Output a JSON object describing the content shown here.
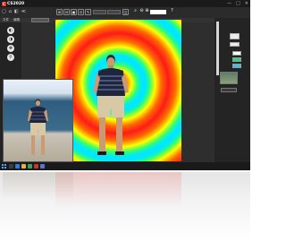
{
  "app": {
    "logo_mark": "C",
    "logo_name": "CS2020"
  },
  "window_controls": [
    "—",
    "□",
    "✕"
  ],
  "toolbar": {
    "left_icons": [
      "▢",
      "⌂",
      "◧",
      "≪"
    ],
    "tools": [
      "⊞",
      "⊟",
      "▣",
      "⊡",
      "✎",
      "◫"
    ],
    "tabs": [
      "",
      "",
      "",
      "",
      "",
      "",
      ""
    ],
    "zoom_icon": "⌕",
    "zoom_controls": [
      "⊖",
      "⊕"
    ],
    "zoom_value": "",
    "help_icon": "?"
  },
  "subbar": {
    "items": [
      "文件",
      "编辑"
    ],
    "chip_label": ""
  },
  "left_tools": [
    "◐",
    "◑",
    "✥",
    "⚲"
  ],
  "taskbar": {
    "time": "",
    "date": ""
  },
  "colors": {
    "accent_red": "#e02020",
    "app_bg": "#2e2e2e",
    "panel_bg": "#242424",
    "taskbar_bg": "#1a1a1a"
  }
}
